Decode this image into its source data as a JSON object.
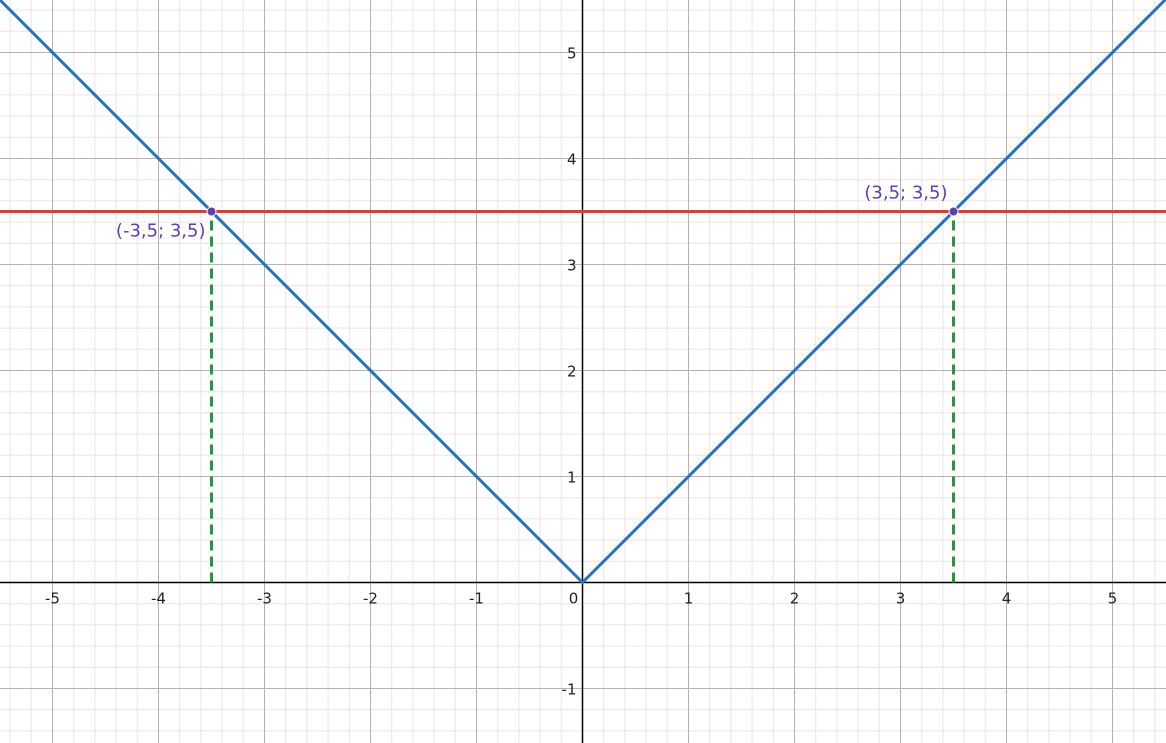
{
  "chart_data": {
    "type": "line",
    "title": "",
    "xlabel": "",
    "ylabel": "",
    "xlim": [
      -5.5,
      5.5
    ],
    "ylim": [
      -1.5,
      5.5
    ],
    "grid": true,
    "minor_grid_step": 0.2,
    "x_ticks": [
      {
        "value": -5,
        "label": "-5"
      },
      {
        "value": -4,
        "label": "-4"
      },
      {
        "value": -3,
        "label": "-3"
      },
      {
        "value": -2,
        "label": "-2"
      },
      {
        "value": -1,
        "label": "-1"
      },
      {
        "value": 0,
        "label": "0"
      },
      {
        "value": 1,
        "label": "1"
      },
      {
        "value": 2,
        "label": "2"
      },
      {
        "value": 3,
        "label": "3"
      },
      {
        "value": 4,
        "label": "4"
      },
      {
        "value": 5,
        "label": "5"
      }
    ],
    "y_ticks": [
      {
        "value": -1,
        "label": "-1"
      },
      {
        "value": 1,
        "label": "1"
      },
      {
        "value": 2,
        "label": "2"
      },
      {
        "value": 3,
        "label": "3"
      },
      {
        "value": 4,
        "label": "4"
      },
      {
        "value": 5,
        "label": "5"
      }
    ],
    "series": [
      {
        "color": "#2d70b3",
        "style": "solid",
        "points": [
          [
            -5.5,
            5.5
          ],
          [
            0,
            0
          ],
          [
            5.5,
            5.5
          ]
        ]
      },
      {
        "color": "#c74440",
        "style": "solid",
        "points": [
          [
            -5.5,
            3.5
          ],
          [
            5.5,
            3.5
          ]
        ]
      },
      {
        "color": "#388c46",
        "style": "dashed",
        "points": [
          [
            -3.5,
            0
          ],
          [
            -3.5,
            3.5
          ]
        ]
      },
      {
        "color": "#388c46",
        "style": "dashed",
        "points": [
          [
            3.5,
            0
          ],
          [
            3.5,
            3.5
          ]
        ]
      }
    ],
    "points": [
      {
        "x": -3.5,
        "y": 3.5,
        "label": "(-3,5; 3,5)",
        "label_position": "below-left"
      },
      {
        "x": 3.5,
        "y": 3.5,
        "label": "(3,5; 3,5)",
        "label_position": "above-left"
      }
    ],
    "point_color": "#6042a6"
  }
}
